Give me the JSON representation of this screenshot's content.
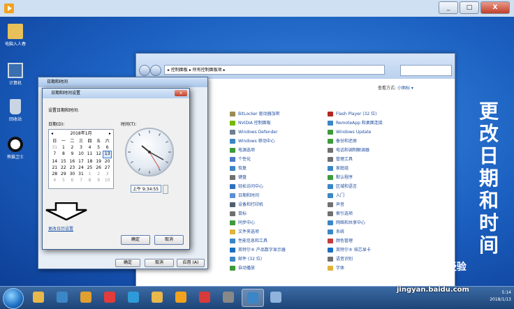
{
  "desktop": {
    "icons": [
      {
        "label": "电脑入人春",
        "icon": "folder-icon"
      },
      {
        "label": "计算机",
        "icon": "computer-icon"
      },
      {
        "label": "回收站",
        "icon": "recycle-bin-icon"
      },
      {
        "label": "熊猫卫士",
        "icon": "panda-icon"
      }
    ],
    "calligraphy": [
      "更",
      "改",
      "日",
      "期",
      "和",
      "时",
      "间"
    ]
  },
  "control_panel": {
    "address": "▸ 控制面板 ▸ 所有控制面板项 ▸",
    "view_by_label": "查看方式:",
    "view_by_value": "小图标 ▾",
    "items_left": [
      {
        "label": "BitLocker 驱动器加密",
        "color": "#9a8d55"
      },
      {
        "label": "NVIDIA 控制面板",
        "color": "#76b900"
      },
      {
        "label": "Windows Defender",
        "color": "#6e7f91"
      },
      {
        "label": "Windows 移动中心",
        "color": "#3b86c6"
      },
      {
        "label": "电源选项",
        "color": "#3e9a3a"
      },
      {
        "label": "个性化",
        "color": "#4c7ac6"
      },
      {
        "label": "恢复",
        "color": "#3b86c6"
      },
      {
        "label": "键盘",
        "color": "#707070"
      },
      {
        "label": "轻松访问中心",
        "color": "#2d6fc1"
      },
      {
        "label": "日期和时间",
        "color": "#5a8fd1"
      },
      {
        "label": "设备和打印机",
        "color": "#505f70"
      },
      {
        "label": "鼠标",
        "color": "#707070"
      },
      {
        "label": "同步中心",
        "color": "#3e9a3a"
      },
      {
        "label": "文件夹选项",
        "color": "#e0b33a"
      },
      {
        "label": "性能信息和工具",
        "color": "#3b86c6"
      },
      {
        "label": "英特尔® 产品数字显示器",
        "color": "#1a6fc0"
      },
      {
        "label": "邮件 (32 位)",
        "color": "#3b86c6"
      },
      {
        "label": "自动播放",
        "color": "#3e9a3a"
      }
    ],
    "items_right": [
      {
        "label": "Flash Player (32 位)",
        "color": "#b5271f"
      },
      {
        "label": "RemoteApp 和桌面连接",
        "color": "#3b86c6"
      },
      {
        "label": "Windows Update",
        "color": "#3e9a3a"
      },
      {
        "label": "备份和还原",
        "color": "#3e9a3a"
      },
      {
        "label": "电话和调制解调器",
        "color": "#707070"
      },
      {
        "label": "管理工具",
        "color": "#707070"
      },
      {
        "label": "家庭组",
        "color": "#3b86c6"
      },
      {
        "label": "默认程序",
        "color": "#3e9a3a"
      },
      {
        "label": "区域和语言",
        "color": "#3b86c6"
      },
      {
        "label": "入门",
        "color": "#3b86c6"
      },
      {
        "label": "声音",
        "color": "#707070"
      },
      {
        "label": "索引选项",
        "color": "#707070"
      },
      {
        "label": "网络和共享中心",
        "color": "#3b86c6"
      },
      {
        "label": "系统",
        "color": "#3b86c6"
      },
      {
        "label": "颜色管理",
        "color": "#c43c3c"
      },
      {
        "label": "英特尔® 核芯显卡",
        "color": "#1a6fc0"
      },
      {
        "label": "语音识别",
        "color": "#707070"
      },
      {
        "label": "字体",
        "color": "#e0b33a"
      }
    ]
  },
  "dt_outer": {
    "title": "日期和时间",
    "ok": "确定",
    "cancel": "取消",
    "apply": "应用 (A)"
  },
  "dt_settings": {
    "title": "日期和时间设置",
    "subtitle": "设置日期和时间:",
    "date_label": "日期(D):",
    "time_label": "时间(T):",
    "month_header": "2018年1月",
    "weekdays": [
      "日",
      "一",
      "二",
      "三",
      "四",
      "五",
      "六"
    ],
    "days": [
      [
        "31",
        "1",
        "2",
        "3",
        "4",
        "5",
        "6"
      ],
      [
        "7",
        "8",
        "9",
        "10",
        "11",
        "12",
        "13"
      ],
      [
        "14",
        "15",
        "16",
        "17",
        "18",
        "19",
        "20"
      ],
      [
        "21",
        "22",
        "23",
        "24",
        "25",
        "26",
        "27"
      ],
      [
        "28",
        "29",
        "30",
        "31",
        "1",
        "2",
        "3"
      ],
      [
        "4",
        "5",
        "6",
        "7",
        "8",
        "9",
        "10"
      ]
    ],
    "selected_day": "13",
    "time_value": "上午  9:34:55",
    "change_link": "更改日历设置",
    "ok": "确定",
    "cancel": "取消",
    "close_glyph": "x"
  },
  "taskbar": {
    "buttons": [
      {
        "name": "explorer",
        "color": "#e8b84a"
      },
      {
        "name": "ie",
        "color": "#3b86c6"
      },
      {
        "name": "browser",
        "color": "#e0a030"
      },
      {
        "name": "sogou",
        "color": "#e23b3b"
      },
      {
        "name": "app",
        "color": "#2f9ad8"
      },
      {
        "name": "folder",
        "color": "#e8b84a"
      },
      {
        "name": "player",
        "color": "#f2a21c"
      },
      {
        "name": "red-app",
        "color": "#d83a3a"
      },
      {
        "name": "tool",
        "color": "#888888"
      },
      {
        "name": "monitor",
        "color": "#3b86c6"
      },
      {
        "name": "grid",
        "color": "#8fb3dd"
      }
    ],
    "tray_time": "5:14",
    "tray_date": "2018/1/13"
  },
  "watermark": {
    "brand": "Bai 经验",
    "url": "jingyan.baidu.com"
  },
  "colors": {
    "desktop": "#1b5fc0",
    "accent": "#1b52a7"
  }
}
